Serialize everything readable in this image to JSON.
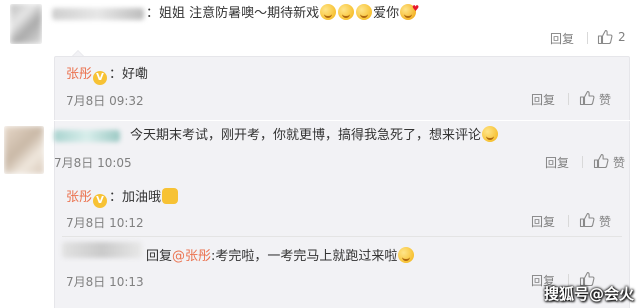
{
  "comment1": {
    "text_before": "：姐姐 注意防暑噢～期待新戏",
    "text_after": "爱你",
    "actions": {
      "reply": "回复",
      "like_count": "2"
    }
  },
  "reply1": {
    "author": "张彤",
    "text": "：好嘞",
    "time": "7月8日 09:32",
    "actions": {
      "reply": "回复",
      "like": "赞"
    }
  },
  "comment2": {
    "text": "今天期末考试，刚开考，你就更博，搞得我急死了，想来评论",
    "time": "7月8日 10:05",
    "actions": {
      "reply": "回复",
      "like": "赞"
    }
  },
  "reply2": {
    "author": "张彤",
    "text": "：加油哦",
    "time": "7月8日 10:12",
    "actions": {
      "reply": "回复",
      "like": "赞"
    }
  },
  "reply3": {
    "prefix": "回复",
    "mention": "@张彤",
    "text": ":考完啦，一考完马上就跑过来啦",
    "time": "7月8日 10:13",
    "actions": {
      "reply": "回复",
      "like": "赞"
    }
  },
  "watermark": "搜狐号@会火",
  "colors": {
    "name": "#eb7350",
    "meta": "#808080",
    "reply_bg": "#f2f2f5",
    "vip_badge": "#f7c234"
  },
  "icons": {
    "like": "thumbs-up-icon",
    "vip": "verified-v-badge-icon",
    "emoji": "smile-emoji-icon"
  }
}
